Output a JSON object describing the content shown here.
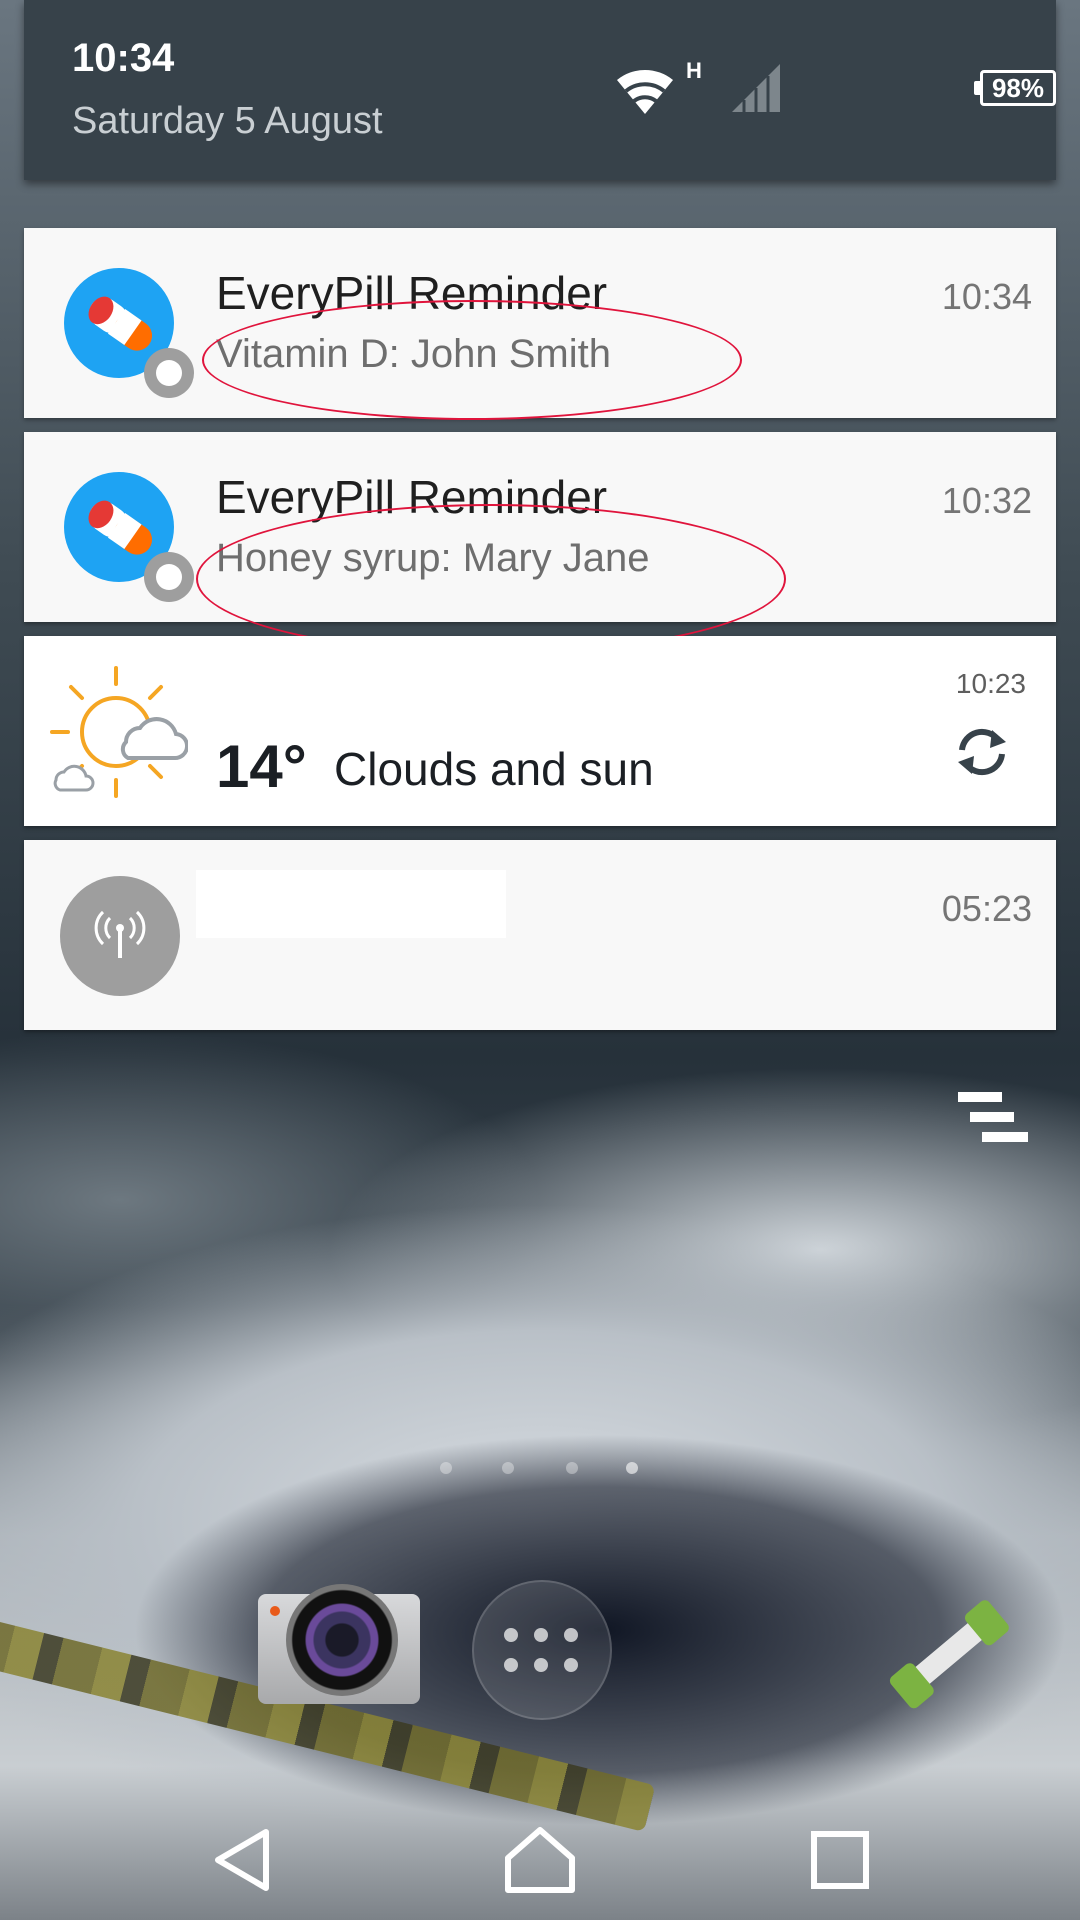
{
  "status_bar": {
    "time": "10:34",
    "date": "Saturday 5 August",
    "network_type": "H",
    "battery_percent": "98%",
    "icons": [
      "wifi-icon",
      "cellular-signal-icon",
      "battery-icon"
    ]
  },
  "notifications": [
    {
      "app_name": "EveryPill Reminder",
      "text": "Vitamin D: John Smith",
      "time": "10:34",
      "icon": "pill-icon",
      "highlight_color": "#e0143c"
    },
    {
      "app_name": "EveryPill Reminder",
      "text": "Honey syrup: Mary Jane",
      "time": "10:32",
      "icon": "pill-icon",
      "highlight_color": "#e0143c"
    }
  ],
  "weather": {
    "temperature": "14°",
    "condition": "Clouds and sun",
    "time": "10:23",
    "icon": "sun-cloud-icon"
  },
  "broadcast_notification": {
    "title": "",
    "time": "05:23",
    "icon": "broadcast-antenna-icon"
  },
  "actions": {
    "clear_all_icon": "clear-all-icon"
  },
  "dock": {
    "apps": [
      "camera-app-icon",
      "app-drawer-icon",
      "phone-app-icon"
    ]
  },
  "navigation": {
    "buttons": [
      "back-icon",
      "home-icon",
      "recents-icon"
    ]
  },
  "colors": {
    "header_bg": "#37424a",
    "card_bg": "#f8f8f8",
    "pill_app_blue": "#1ea3f3",
    "annotation_red": "#e0143c"
  }
}
